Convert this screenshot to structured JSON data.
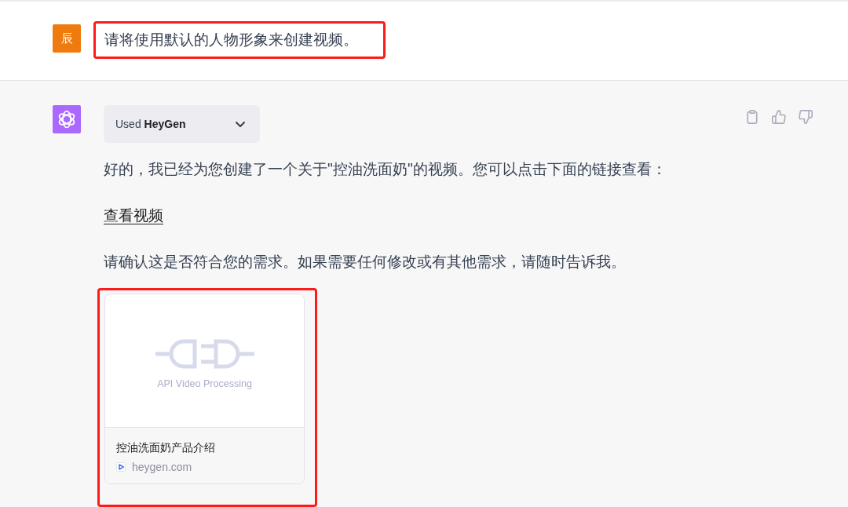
{
  "user_message": {
    "avatar_letter": "辰",
    "text": "请将使用默认的人物形象来创建视频。",
    "highlighted": true
  },
  "assistant_message": {
    "tool_chip": {
      "label": "Used **HeyGen**",
      "expanded": false
    },
    "paragraphs": [
      {
        "kind": "text",
        "text": "好的，我已经为您创建了一个关于\"控油洗面奶\"的视频。您可以点击下面的链接查看："
      },
      {
        "kind": "link",
        "text": "查看视频"
      },
      {
        "kind": "text",
        "text": "请确认这是否符合您的需求。如果需要任何修改或有其他需求，请随时告诉我。"
      }
    ],
    "link_card": {
      "image_caption": "API Video Processing",
      "title": "控油洗面奶产品介绍",
      "domain": "heygen.com",
      "highlighted": true
    }
  }
}
